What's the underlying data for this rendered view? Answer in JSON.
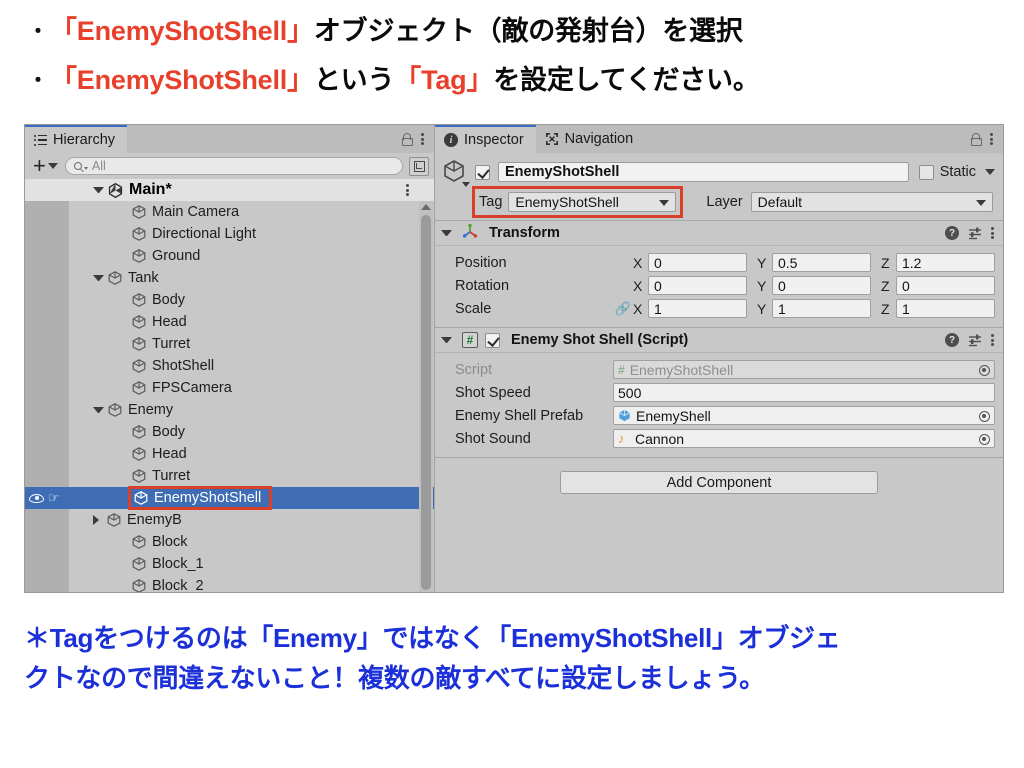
{
  "slide": {
    "bullets": [
      {
        "parts": [
          {
            "t": "「EnemyShotShell」",
            "c": "red"
          },
          {
            "t": "オブジェクト（敵の発射台）を選択",
            "c": "blk"
          }
        ]
      },
      {
        "parts": [
          {
            "t": "「EnemyShotShell」",
            "c": "red"
          },
          {
            "t": "という",
            "c": "blk"
          },
          {
            "t": "「Tag」",
            "c": "red"
          },
          {
            "t": "を設定してください。",
            "c": "blk"
          }
        ]
      }
    ],
    "bullet_marker": "・",
    "note_line1": "＊Tagをつけるのは「Enemy」ではなく「EnemyShotShell」オブジェ",
    "note_line2": "クトなので間違えないこと！複数の敵すべてに設定しましょう。",
    "colors": {
      "accent_red": "#e8402a",
      "note_blue": "#1b30d8",
      "body_black": "#0a0a0a"
    }
  },
  "hierarchy": {
    "tab_label": "Hierarchy",
    "tab_icon": "hierarchy-list-icon",
    "lock_icon": "lock-icon",
    "menu_icon": "kebab-menu-icon",
    "create_label": "+",
    "search_placeholder": "All",
    "search_value": "",
    "expand_icon": "expand-window-icon",
    "root": {
      "label": "Main*",
      "icon": "unity-scene-icon",
      "expanded": true
    },
    "items": [
      {
        "label": "Main Camera",
        "depth": 2,
        "toggle": "none",
        "selected": false
      },
      {
        "label": "Directional Light",
        "depth": 2,
        "toggle": "none",
        "selected": false
      },
      {
        "label": "Ground",
        "depth": 2,
        "toggle": "none",
        "selected": false
      },
      {
        "label": "Tank",
        "depth": 1,
        "toggle": "expanded",
        "selected": false
      },
      {
        "label": "Body",
        "depth": 2,
        "toggle": "none",
        "selected": false
      },
      {
        "label": "Head",
        "depth": 2,
        "toggle": "none",
        "selected": false
      },
      {
        "label": "Turret",
        "depth": 2,
        "toggle": "none",
        "selected": false
      },
      {
        "label": "ShotShell",
        "depth": 2,
        "toggle": "none",
        "selected": false
      },
      {
        "label": "FPSCamera",
        "depth": 2,
        "toggle": "none",
        "selected": false
      },
      {
        "label": "Enemy",
        "depth": 1,
        "toggle": "expanded",
        "selected": false
      },
      {
        "label": "Body",
        "depth": 2,
        "toggle": "none",
        "selected": false
      },
      {
        "label": "Head",
        "depth": 2,
        "toggle": "none",
        "selected": false
      },
      {
        "label": "Turret",
        "depth": 2,
        "toggle": "none",
        "selected": false
      },
      {
        "label": "EnemyShotShell",
        "depth": 2,
        "toggle": "none",
        "selected": true,
        "highlight": true
      },
      {
        "label": "EnemyB",
        "depth": 1,
        "toggle": "collapsed",
        "selected": false
      },
      {
        "label": "Block",
        "depth": 2,
        "toggle": "none",
        "selected": false
      },
      {
        "label": "Block_1",
        "depth": 2,
        "toggle": "none",
        "selected": false
      },
      {
        "label": "Block_2",
        "depth": 2,
        "toggle": "none",
        "selected": false
      }
    ]
  },
  "inspector": {
    "tabs": [
      {
        "label": "Inspector",
        "icon": "info-icon",
        "active": true
      },
      {
        "label": "Navigation",
        "icon": "navigation-icon",
        "active": false
      }
    ],
    "lock_icon": "lock-icon",
    "menu_icon": "kebab-menu-icon",
    "object": {
      "enabled": true,
      "name": "EnemyShotShell",
      "static_label": "Static",
      "static_checked": false,
      "tag_label": "Tag",
      "tag_value": "EnemyShotShell",
      "layer_label": "Layer",
      "layer_value": "Default",
      "tag_highlighted": true
    },
    "transform": {
      "title": "Transform",
      "icon": "transform-axis-icon",
      "expanded": true,
      "rows": [
        {
          "label": "Position",
          "x": "0",
          "y": "0.5",
          "z": "1.2",
          "link": false
        },
        {
          "label": "Rotation",
          "x": "0",
          "y": "0",
          "z": "0",
          "link": false
        },
        {
          "label": "Scale",
          "x": "1",
          "y": "1",
          "z": "1",
          "link": true
        }
      ],
      "axis_labels": [
        "X",
        "Y",
        "Z"
      ],
      "help_icon": "help-icon",
      "preset_icon": "preset-icon",
      "menu_icon": "kebab-menu-icon"
    },
    "script_component": {
      "title": "Enemy Shot Shell (Script)",
      "icon": "cs-script-icon",
      "enabled": true,
      "expanded": true,
      "help_icon": "help-icon",
      "preset_icon": "preset-icon",
      "menu_icon": "kebab-menu-icon",
      "fields": [
        {
          "label": "Script",
          "value": "EnemyShotShell",
          "kind": "script-ref",
          "dim": true,
          "picker": true
        },
        {
          "label": "Shot Speed",
          "value": "500",
          "kind": "number",
          "dim": false,
          "picker": false
        },
        {
          "label": "Enemy Shell Prefab",
          "value": "EnemyShell",
          "kind": "prefab-ref",
          "dim": false,
          "picker": true
        },
        {
          "label": "Shot Sound",
          "value": "Cannon",
          "kind": "audio-ref",
          "dim": false,
          "picker": true
        }
      ]
    },
    "add_component_label": "Add Component"
  }
}
